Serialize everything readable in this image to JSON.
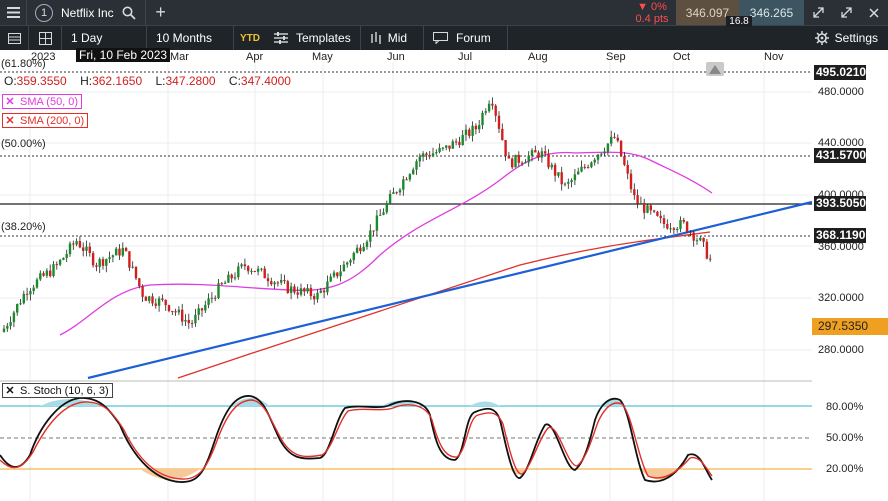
{
  "toolbar": {
    "symbol_number": "1",
    "symbol_name": "Netflix Inc",
    "change_pct": "▼ 0%",
    "change_pts": "0.4 pts",
    "bid": "346.097",
    "spread": "16.8",
    "ask": "346.265"
  },
  "toolbar2": {
    "interval": "1 Day",
    "range": "10 Months",
    "ytd": "YTD",
    "templates": "Templates",
    "price_type": "Mid",
    "forum": "Forum",
    "settings": "Settings"
  },
  "hover_date": "Fri, 10 Feb 2023",
  "ohlc": {
    "o_label": "O:",
    "o": "359.3550",
    "h_label": "H:",
    "h": "362.1650",
    "l_label": "L:",
    "l": "347.2800",
    "c_label": "C:",
    "c": "347.4000"
  },
  "indicators": {
    "sma50": "SMA (50, 0)",
    "sma200": "SMA (200, 0)",
    "stoch": "S. Stoch (10, 6, 3)"
  },
  "fib_labels": {
    "f618": "(61.80%)",
    "f50": "(50.00%)",
    "f382": "(38.20%)"
  },
  "colors": {
    "up": "#1a8a2c",
    "down": "#d11f1f",
    "sma50": "#e03ce0",
    "sma200": "#e0302a",
    "trend": "#1d5fd6",
    "accent": "#f0a020"
  },
  "chart_data": {
    "type": "line",
    "months": [
      "2023",
      "Mar",
      "Apr",
      "May",
      "Jun",
      "Jul",
      "Aug",
      "Sep",
      "Oct",
      "Nov"
    ],
    "price_ticks": [
      "480.0000",
      "440.0000",
      "400.0000",
      "360.0000",
      "320.0000",
      "280.0000"
    ],
    "price_levels": [
      {
        "value": "495.0210",
        "style": "dark"
      },
      {
        "value": "431.5700",
        "style": "dark"
      },
      {
        "value": "393.5050",
        "style": "dark"
      },
      {
        "value": "368.1190",
        "style": "dark"
      },
      {
        "value": "297.5350",
        "style": "orange"
      }
    ],
    "stoch_ticks": [
      "80.00%",
      "50.00%",
      "20.00%"
    ],
    "close_series": [
      {
        "date": "2023-01-03",
        "close": 294
      },
      {
        "date": "2023-01-13",
        "close": 327
      },
      {
        "date": "2023-01-25",
        "close": 345
      },
      {
        "date": "2023-02-02",
        "close": 365
      },
      {
        "date": "2023-02-10",
        "close": 347
      },
      {
        "date": "2023-02-21",
        "close": 358
      },
      {
        "date": "2023-03-01",
        "close": 322
      },
      {
        "date": "2023-03-10",
        "close": 316
      },
      {
        "date": "2023-03-20",
        "close": 300
      },
      {
        "date": "2023-03-31",
        "close": 327
      },
      {
        "date": "2023-04-11",
        "close": 346
      },
      {
        "date": "2023-04-19",
        "close": 338
      },
      {
        "date": "2023-04-28",
        "close": 328
      },
      {
        "date": "2023-05-10",
        "close": 322
      },
      {
        "date": "2023-05-22",
        "close": 348
      },
      {
        "date": "2023-05-31",
        "close": 370
      },
      {
        "date": "2023-06-08",
        "close": 396
      },
      {
        "date": "2023-06-20",
        "close": 430
      },
      {
        "date": "2023-06-30",
        "close": 435
      },
      {
        "date": "2023-07-13",
        "close": 452
      },
      {
        "date": "2023-07-19",
        "close": 478
      },
      {
        "date": "2023-07-26",
        "close": 425
      },
      {
        "date": "2023-08-08",
        "close": 433
      },
      {
        "date": "2023-08-18",
        "close": 406
      },
      {
        "date": "2023-08-30",
        "close": 431
      },
      {
        "date": "2023-09-07",
        "close": 445
      },
      {
        "date": "2023-09-15",
        "close": 396
      },
      {
        "date": "2023-09-26",
        "close": 378
      },
      {
        "date": "2023-10-05",
        "close": 377
      },
      {
        "date": "2023-10-12",
        "close": 362
      },
      {
        "date": "2023-10-16",
        "close": 347
      }
    ]
  }
}
